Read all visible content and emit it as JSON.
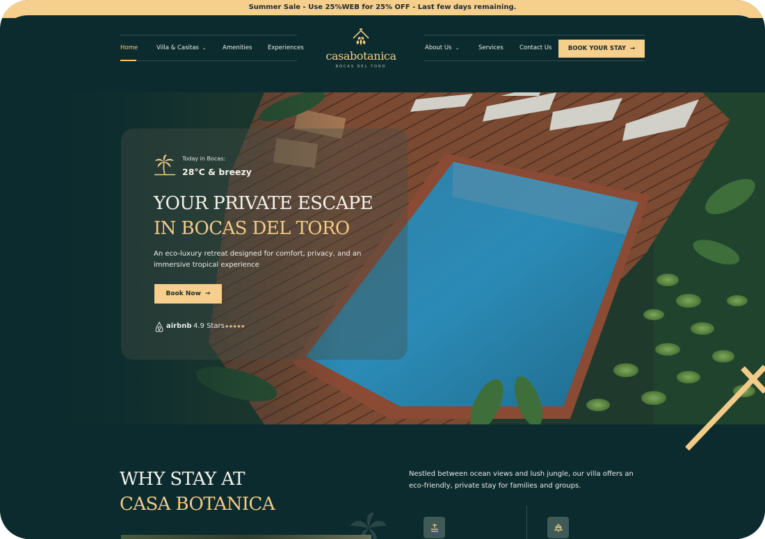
{
  "announcement": "Summer Sale - Use 25%WEB for 25% OFF - Last few days remaining.",
  "nav": {
    "left": [
      {
        "label": "Home",
        "active": true
      },
      {
        "label": "Villa & Casitas",
        "dropdown": true
      },
      {
        "label": "Amenities"
      },
      {
        "label": "Experiences"
      }
    ],
    "right": [
      {
        "label": "About Us",
        "dropdown": true
      },
      {
        "label": "Services"
      },
      {
        "label": "Contact Us"
      }
    ],
    "cta": "BOOK YOUR STAY",
    "chevron": "⌄",
    "arrow": "→"
  },
  "logo": {
    "wordmark": "casabotanica",
    "tagline": "BOCAS DEL TORO"
  },
  "hero": {
    "weather_label": "Today in Bocas:",
    "weather_value": "28°C & breezy",
    "title_line1": "YOUR PRIVATE ESCAPE",
    "title_line2": "IN BOCAS DEL TORO",
    "description": "An eco-luxury retreat designed for comfort, privacy, and an immersive tropical experience",
    "button": "Book Now",
    "review_platform": "airbnb",
    "rating": "4.9 Stars",
    "stars": "★★★★★"
  },
  "why": {
    "title_line1": "WHY STAY AT",
    "title_line2": "CASA BOTANICA",
    "description": "Nestled between ocean views and lush jungle, our villa offers an eco-friendly, private stay for families and groups."
  },
  "colors": {
    "background": "#0c2b2e",
    "accent": "#f6cf8c",
    "gold_text": "#f2cb88"
  },
  "icons": [
    "palm-tree-icon",
    "airbnb-icon",
    "arrow-right-icon",
    "chevron-down-icon",
    "house-leaf-logo-icon",
    "feature-icon"
  ]
}
